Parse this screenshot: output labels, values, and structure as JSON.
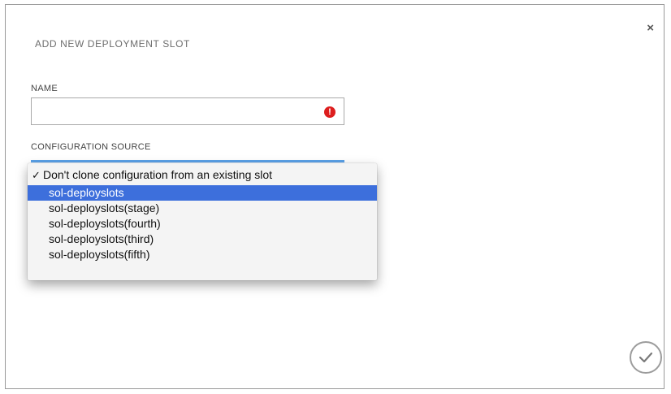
{
  "dialog": {
    "title": "ADD NEW DEPLOYMENT SLOT",
    "close_symbol": "×"
  },
  "name_field": {
    "label": "NAME",
    "value": "",
    "error_icon_symbol": "!"
  },
  "config_source": {
    "label": "CONFIGURATION SOURCE",
    "check_symbol": "✓",
    "options": [
      "Don't clone configuration from an existing slot",
      "sol-deployslots",
      "sol-deployslots(stage)",
      "sol-deployslots(fourth)",
      "sol-deployslots(third)",
      "sol-deployslots(fifth)"
    ]
  },
  "colors": {
    "highlight": "#3d6fdc",
    "error": "#dd1e1e",
    "focus_underline": "#5aa0e6"
  }
}
